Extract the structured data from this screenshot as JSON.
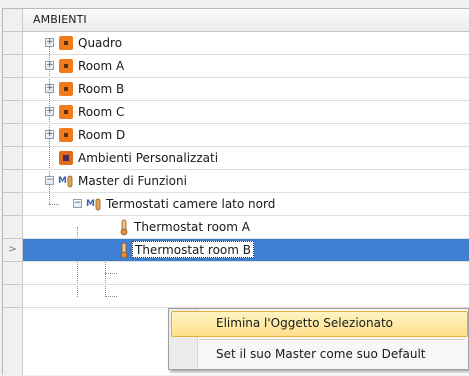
{
  "grid": {
    "column_header": "AMBIENTI"
  },
  "tree": {
    "items": [
      {
        "label": "Quadro",
        "icon": "room-icon",
        "expander": "+"
      },
      {
        "label": "Room A",
        "icon": "room-icon",
        "expander": "+"
      },
      {
        "label": "Room B",
        "icon": "room-icon",
        "expander": "+"
      },
      {
        "label": "Room C",
        "icon": "room-icon",
        "expander": "+"
      },
      {
        "label": "Room D",
        "icon": "room-icon",
        "expander": "+"
      },
      {
        "label": "Ambienti Personalizzati",
        "icon": "custom-room-icon",
        "expander": ""
      },
      {
        "label": "Master di Funzioni",
        "icon": "master-icon",
        "expander": "−"
      },
      {
        "label": "Termostati camere lato nord",
        "icon": "master-icon",
        "expander": "−"
      },
      {
        "label": "Thermostat room A",
        "icon": "thermostat-icon",
        "expander": ""
      },
      {
        "label": "Thermostat room B",
        "icon": "thermostat-icon",
        "expander": "",
        "selected": true
      }
    ],
    "current_row_marker": ">"
  },
  "context_menu": {
    "items": [
      {
        "label": "Elimina l'Oggetto Selezionato",
        "highlighted": true
      },
      {
        "label": "Set il suo Master come suo Default",
        "highlighted": false
      }
    ]
  },
  "colors": {
    "selection": "#3f7fd2",
    "room_icon": "#f07c1e",
    "menu_highlight": "#ffe08a"
  }
}
